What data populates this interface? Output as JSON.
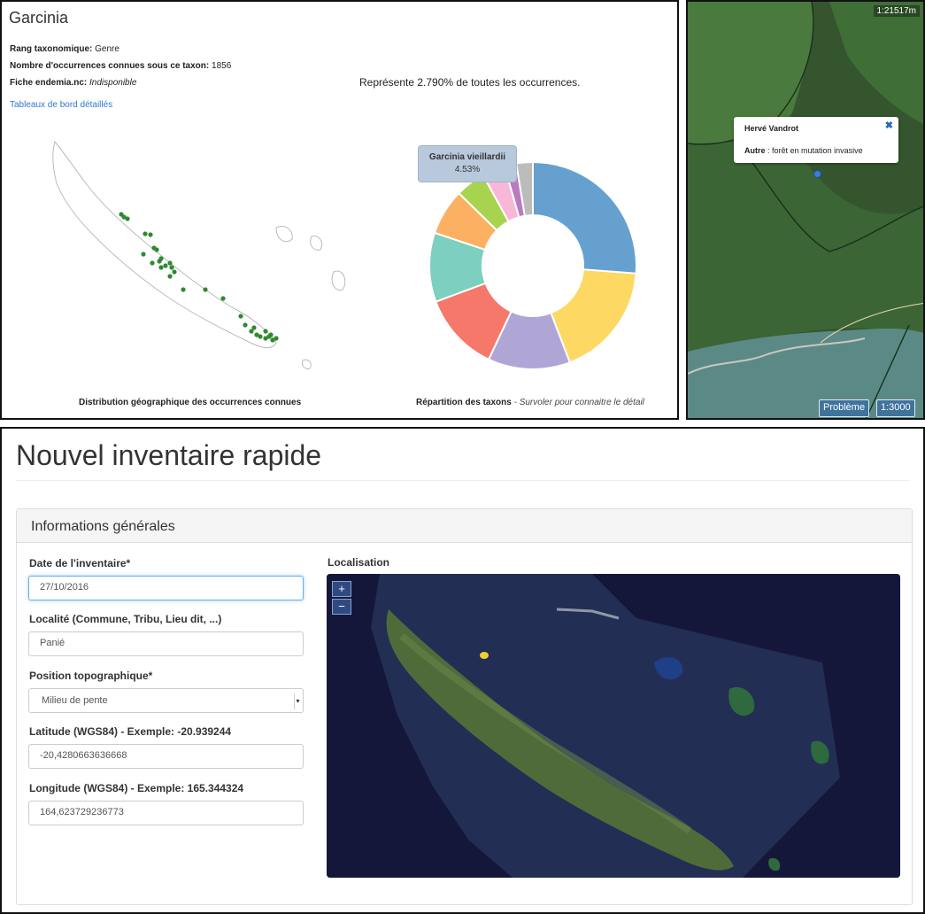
{
  "taxon": {
    "name": "Garcinia",
    "rank_label": "Rang taxonomique:",
    "rank_value": "Genre",
    "occ_label": "Nombre d'occurrences connues sous ce taxon:",
    "occ_value": "1856",
    "fiche_label": "Fiche endemia.nc:",
    "fiche_value": "Indisponible",
    "dashboard_link": "Tableaux de bord détaillés",
    "share_text": "Représente 2.790% de toutes les occurrences.",
    "map_caption": "Distribution géographique des occurrences connues",
    "pie_caption": "Répartition des taxons",
    "pie_caption_hint": "- Survoler pour connaitre le détail",
    "tooltip_name": "Garcinia vieillardii",
    "tooltip_value": "4.53%"
  },
  "chart_data": {
    "type": "pie",
    "donut": true,
    "title": "",
    "slices": [
      {
        "label": "",
        "value": 25.5,
        "color": "#65a0cf"
      },
      {
        "label": "",
        "value": 17.5,
        "color": "#fdd862"
      },
      {
        "label": "",
        "value": 12.5,
        "color": "#b0a6d6"
      },
      {
        "label": "",
        "value": 12.0,
        "color": "#f6786a"
      },
      {
        "label": "",
        "value": 10.5,
        "color": "#7dcfbf"
      },
      {
        "label": "",
        "value": 7.0,
        "color": "#fcb062"
      },
      {
        "label": "Garcinia vieillardii",
        "value": 4.53,
        "color": "#a8d34f"
      },
      {
        "label": "",
        "value": 3.5,
        "color": "#f8b7d9"
      },
      {
        "label": "",
        "value": 1.8,
        "color": "#b97bbf"
      },
      {
        "label": "",
        "value": 2.5,
        "color": "#bcbcbc"
      }
    ]
  },
  "satellite": {
    "scale_top": "1:21517m",
    "popup_name": "Hervé Vandrot",
    "popup_key": "Autre",
    "popup_text": ": forêt en mutation invasive",
    "close_glyph": "✖",
    "problem_button": "Problème",
    "scale_button": "1:3000",
    "colors": {
      "forest": "#3f6a3a",
      "outline": "#1c3a1c",
      "water": "#5b8a86"
    }
  },
  "form": {
    "title": "Nouvel inventaire rapide",
    "section": "Informations générales",
    "date_label": "Date de l'inventaire*",
    "date_value": "27/10/2016",
    "locality_label": "Localité (Commune, Tribu, Lieu dit, ...)",
    "locality_value": "Panié",
    "topo_label": "Position topographique*",
    "topo_value": "Milieu de pente",
    "lat_label": "Latitude (WGS84) - Exemple: -20.939244",
    "lat_value": "-20,4280663636668",
    "lon_label": "Longitude (WGS84) - Exemple: 165.344324",
    "lon_value": "164,623729236773",
    "map_label": "Localisation",
    "zoom_in": "+",
    "zoom_out": "−"
  }
}
